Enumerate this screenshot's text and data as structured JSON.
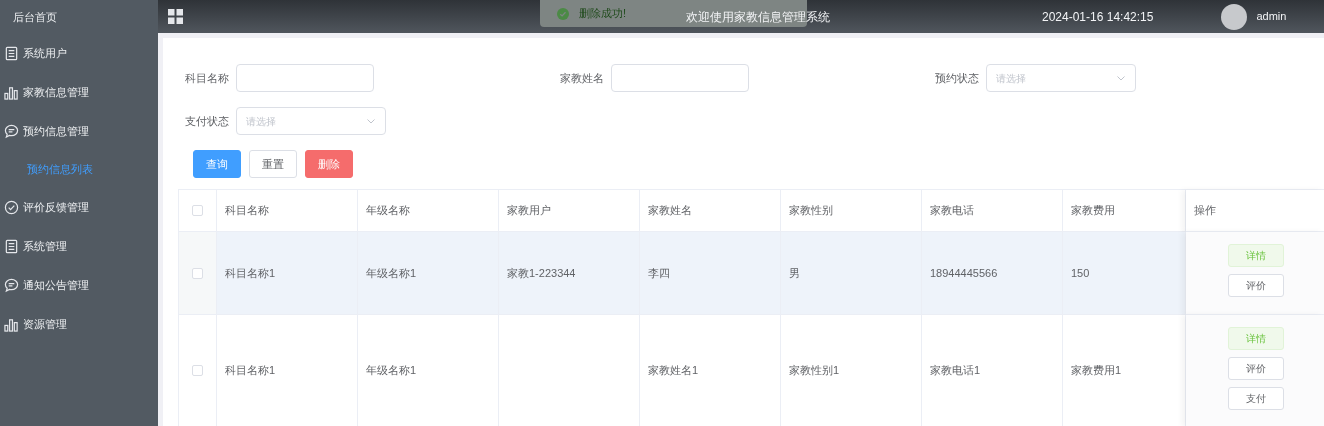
{
  "sidebar": {
    "home": "后台首页",
    "items": [
      {
        "label": "系统用户",
        "kind": "doc"
      },
      {
        "label": "家教信息管理",
        "kind": "bar"
      },
      {
        "label": "预约信息管理",
        "kind": "chat",
        "children": [
          {
            "label": "预约信息列表",
            "selected": true
          }
        ]
      },
      {
        "label": "评价反馈管理",
        "kind": "check"
      },
      {
        "label": "系统管理",
        "kind": "doc"
      },
      {
        "label": "通知公告管理",
        "kind": "chat"
      },
      {
        "label": "资源管理",
        "kind": "bar"
      }
    ]
  },
  "header": {
    "title": "欢迎使用家教信息管理系统",
    "datetime": "2024-01-16 14:42:15",
    "user": "admin"
  },
  "toast": {
    "message": "删除成功!",
    "kind": "success"
  },
  "filters": [
    {
      "label": "科目名称",
      "kind": "input"
    },
    {
      "label": "家教姓名",
      "kind": "input"
    },
    {
      "label": "预约状态",
      "kind": "select",
      "placeholder": "请选择"
    },
    {
      "label": "支付状态",
      "kind": "select",
      "placeholder": "请选择"
    }
  ],
  "buttons": [
    {
      "label": "查询",
      "kind": "primary"
    },
    {
      "label": "重置",
      "kind": "default"
    },
    {
      "label": "删除",
      "kind": "danger"
    }
  ],
  "table": {
    "all_selected": false,
    "columns": [
      "科目名称",
      "年级名称",
      "家教用户",
      "家教姓名",
      "家教性别",
      "家教电话",
      "家教费用"
    ],
    "action_column": "操作",
    "rows": [
      {
        "selected": false,
        "hovered": true,
        "cells": [
          "科目名称1",
          "年级名称1",
          "家教1-223344",
          "李四",
          "男",
          "18944445566",
          "150"
        ],
        "actions": [
          {
            "label": "详情",
            "kind": "success"
          },
          {
            "label": "评价",
            "kind": "default"
          }
        ]
      },
      {
        "selected": false,
        "hovered": false,
        "cells": [
          "科目名称1",
          "年级名称1",
          "",
          "家教姓名1",
          "家教性别1",
          "家教电话1",
          "家教费用1"
        ],
        "actions": [
          {
            "label": "详情",
            "kind": "success"
          },
          {
            "label": "评价",
            "kind": "default"
          },
          {
            "label": "支付",
            "kind": "default"
          }
        ]
      }
    ]
  }
}
